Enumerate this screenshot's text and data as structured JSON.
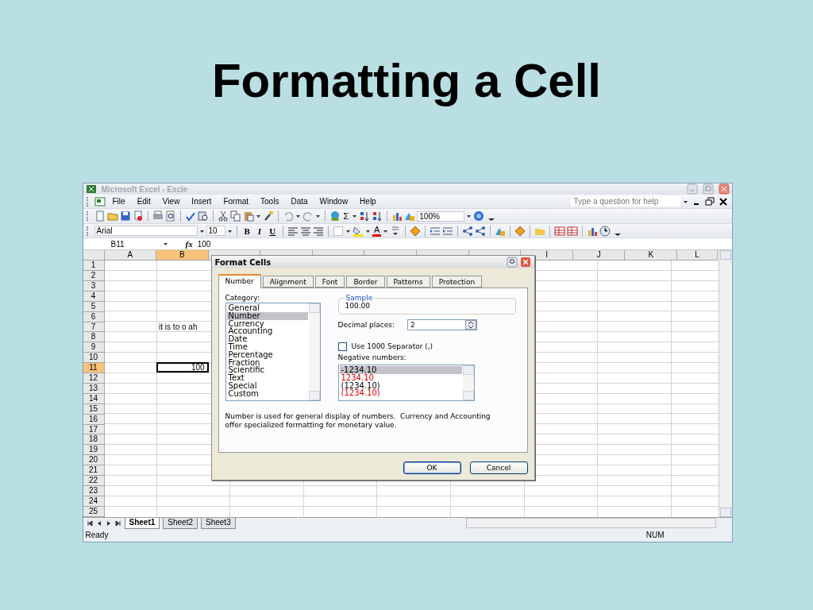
{
  "slide_title": "Formatting a Cell",
  "window": {
    "title": "Microsoft Excel - Excle",
    "active": false
  },
  "menu_bar": {
    "items": [
      "File",
      "Edit",
      "View",
      "Insert",
      "Format",
      "Tools",
      "Data",
      "Window",
      "Help"
    ],
    "help_placeholder": "Type a question for help"
  },
  "standard_toolbar": {
    "sum_symbol": "Σ",
    "zoom": "100%"
  },
  "formatting_toolbar": {
    "font": "Arial",
    "size": "10",
    "style_buttons": [
      "B",
      "I",
      "U"
    ],
    "font_color_letter": "A"
  },
  "formula_bar": {
    "name_box": "B11",
    "fx": "fx",
    "value": "100"
  },
  "sheet": {
    "columns": [
      {
        "label": "A",
        "selected": false
      },
      {
        "label": "B",
        "selected": true
      },
      {
        "selected": false
      },
      {
        "selected": false
      },
      {
        "selected": false
      },
      {
        "selected": false
      },
      {
        "selected": false
      },
      {
        "selected": false
      },
      {
        "label": "I",
        "selected": false
      },
      {
        "label": "J",
        "selected": false
      },
      {
        "label": "K",
        "selected": false
      },
      {
        "label": "L",
        "selected": false
      }
    ],
    "rows": [
      {
        "label": "1",
        "selected": false
      },
      {
        "label": "2",
        "selected": false
      },
      {
        "label": "3",
        "selected": false
      },
      {
        "label": "4",
        "selected": false
      },
      {
        "label": "5",
        "selected": false
      },
      {
        "label": "6",
        "selected": false
      },
      {
        "label": "7",
        "selected": false,
        "column_b": {
          "text": "it is to o ah",
          "active": false
        }
      },
      {
        "label": "8",
        "selected": false
      },
      {
        "label": "9",
        "selected": false
      },
      {
        "label": "10",
        "selected": false
      },
      {
        "label": "11",
        "selected": true,
        "column_b": {
          "text": "100",
          "active": true
        }
      },
      {
        "label": "12",
        "selected": false
      },
      {
        "label": "13",
        "selected": false
      },
      {
        "label": "14",
        "selected": false
      },
      {
        "label": "15",
        "selected": false
      },
      {
        "label": "16",
        "selected": false
      },
      {
        "label": "17",
        "selected": false
      },
      {
        "label": "18",
        "selected": false
      },
      {
        "label": "19",
        "selected": false
      },
      {
        "label": "20",
        "selected": false
      },
      {
        "label": "21",
        "selected": false
      },
      {
        "label": "22",
        "selected": false
      },
      {
        "label": "23",
        "selected": false
      },
      {
        "label": "24",
        "selected": false
      },
      {
        "label": "25",
        "selected": false
      }
    ]
  },
  "sheet_tabs": [
    {
      "label": "Sheet1",
      "selected": true
    },
    {
      "label": "Sheet2",
      "selected": false
    },
    {
      "label": "Sheet3",
      "selected": false
    }
  ],
  "status_bar": {
    "status": "Ready",
    "num_lock": "NUM"
  },
  "dialog": {
    "title": "Format Cells",
    "tabs": [
      {
        "label": "Number",
        "selected": true
      },
      {
        "label": "Alignment",
        "selected": false
      },
      {
        "label": "Font",
        "selected": false
      },
      {
        "label": "Border",
        "selected": false
      },
      {
        "label": "Patterns",
        "selected": false
      },
      {
        "label": "Protection",
        "selected": false
      }
    ],
    "category_label": "Category:",
    "categories": [
      {
        "label": "General",
        "selected": false
      },
      {
        "label": "Number",
        "selected": true
      },
      {
        "label": "Currency",
        "selected": false
      },
      {
        "label": "Accounting",
        "selected": false
      },
      {
        "label": "Date",
        "selected": false
      },
      {
        "label": "Time",
        "selected": false
      },
      {
        "label": "Percentage",
        "selected": false
      },
      {
        "label": "Fraction",
        "selected": false
      },
      {
        "label": "Scientific",
        "selected": false
      },
      {
        "label": "Text",
        "selected": false
      },
      {
        "label": "Special",
        "selected": false
      },
      {
        "label": "Custom",
        "selected": false
      }
    ],
    "sample_label": "Sample",
    "sample_value": "100.00",
    "decimal_label": "Decimal places:",
    "decimal_value": "2",
    "separator": {
      "label": "Use 1000 Separator (,)",
      "checked": false
    },
    "negative_label": "Negative numbers:",
    "negative_formats": [
      {
        "label": "-1234.10",
        "selected": true,
        "color": "#000000"
      },
      {
        "label": "1234.10",
        "selected": false,
        "color": "#e00000"
      },
      {
        "label": "(1234.10)",
        "selected": false,
        "color": "#000000"
      },
      {
        "label": "(1234.10)",
        "selected": false,
        "color": "#e00000"
      }
    ],
    "description": "Number is used for general display of numbers.  Currency and Accounting offer specialized formatting for monetary value.",
    "buttons": [
      {
        "label": "OK",
        "default": true
      },
      {
        "label": "Cancel",
        "default": false
      }
    ]
  }
}
